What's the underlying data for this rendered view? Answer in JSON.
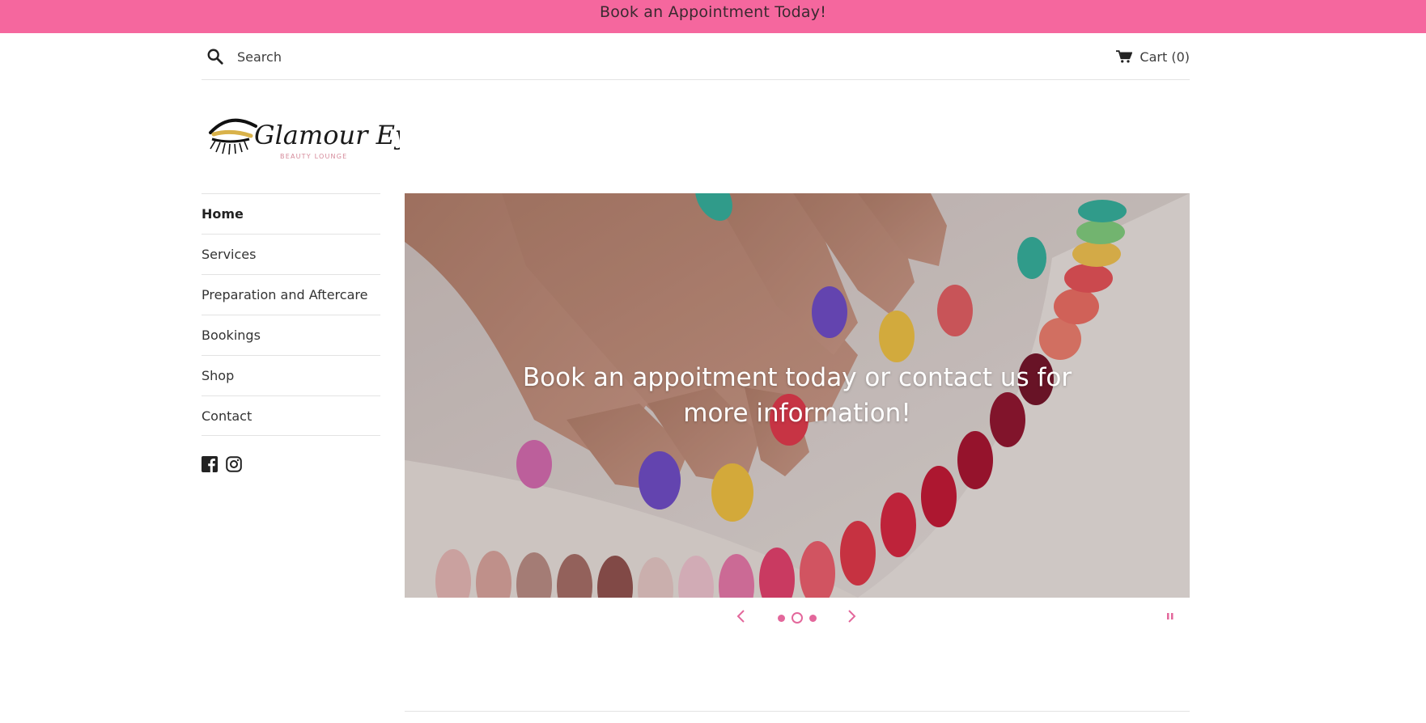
{
  "announcement": {
    "text": "Book an Appointment Today!"
  },
  "header": {
    "search_placeholder": "Search",
    "cart_label": "Cart (0)"
  },
  "logo": {
    "brand": "Glamour Eyes",
    "tagline": "BEAUTY LOUNGE"
  },
  "nav": {
    "items": [
      {
        "label": "Home",
        "active": true
      },
      {
        "label": "Services"
      },
      {
        "label": "Preparation and Aftercare"
      },
      {
        "label": "Bookings"
      },
      {
        "label": "Shop"
      },
      {
        "label": "Contact"
      }
    ]
  },
  "social": {
    "icons": [
      "facebook-icon",
      "instagram-icon"
    ]
  },
  "hero": {
    "caption": "Book an appoitment today or contact us for more information!",
    "slide_count": 3,
    "current_slide": 2
  },
  "colors": {
    "accent": "#f5679e",
    "dot": "#e3679b",
    "text": "#333333"
  }
}
